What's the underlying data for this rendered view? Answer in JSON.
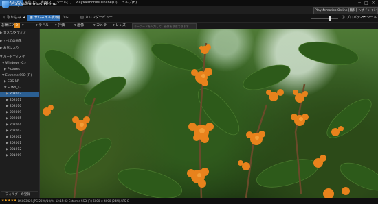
{
  "menubar": {
    "items": [
      "ファイル(F)",
      "編集(E)",
      "表示(V)",
      "ツール(T)",
      "PlayMemories Online(O)",
      "ヘルプ(H)"
    ]
  },
  "titlebar": {
    "app_title": "PlayMemories Home",
    "online_button": "PlayMemories Online [無料] へサインイン"
  },
  "toolbar": {
    "import": "取り込み",
    "thumbnail": "サムネイル表示",
    "calendar_short": "カレ",
    "calendar_view": "カレンダービュー",
    "properties": "プロパティー",
    "tools": "ツール"
  },
  "filterbar": {
    "favorites": "お気に入り",
    "fav_count": "0",
    "label": "ラベル",
    "evaluation": "評価",
    "image": "画像",
    "camera": "カメラ",
    "lens": "レンズ",
    "search_placeholder": "キーワードを入力して、画像を検索できます"
  },
  "sidebar": {
    "items": [
      {
        "label": "カメラ/メディア",
        "arrow": "▶",
        "level": 0
      },
      {
        "label": "すべての画像",
        "arrow": "▶",
        "level": 0
      },
      {
        "label": "お気に入り",
        "arrow": "▶",
        "level": 0
      },
      {
        "label": "ハードディスク",
        "arrow": "▼",
        "level": 0
      },
      {
        "label": "Windows (C:)",
        "arrow": "▼",
        "level": 1
      },
      {
        "label": "Pictures",
        "arrow": "▶",
        "level": 2
      },
      {
        "label": "Extreme SSD (F:)",
        "arrow": "▼",
        "level": 1
      },
      {
        "label": "EOS RP",
        "arrow": "▶",
        "level": 2
      },
      {
        "label": "SONY_a7",
        "arrow": "▼",
        "level": 2
      },
      {
        "label": "202012",
        "arrow": "▶",
        "level": 3,
        "selected": true
      },
      {
        "label": "202011",
        "arrow": "▶",
        "level": 3
      },
      {
        "label": "202010",
        "arrow": "▶",
        "level": 3
      },
      {
        "label": "202009",
        "arrow": "▶",
        "level": 3
      },
      {
        "label": "202005",
        "arrow": "▶",
        "level": 3
      },
      {
        "label": "202004",
        "arrow": "▶",
        "level": 3
      },
      {
        "label": "202003",
        "arrow": "▶",
        "level": 3
      },
      {
        "label": "202002",
        "arrow": "▶",
        "level": 3
      },
      {
        "label": "202001",
        "arrow": "▶",
        "level": 3
      },
      {
        "label": "201912",
        "arrow": "▶",
        "level": 3
      },
      {
        "label": "201909",
        "arrow": "▶",
        "level": 3
      }
    ],
    "add_folder": "フォルダーの登録"
  },
  "statusbar": {
    "rating": 5,
    "info": "DSC03429.JPG  2020/10/04 12:15:02  Extreme SSD (F:)  6000 × 4000  (24M)  APS-C"
  },
  "colors": {
    "accent": "#2f6fb3",
    "favorite": "#e08a1e",
    "flower": "#e8821c"
  }
}
